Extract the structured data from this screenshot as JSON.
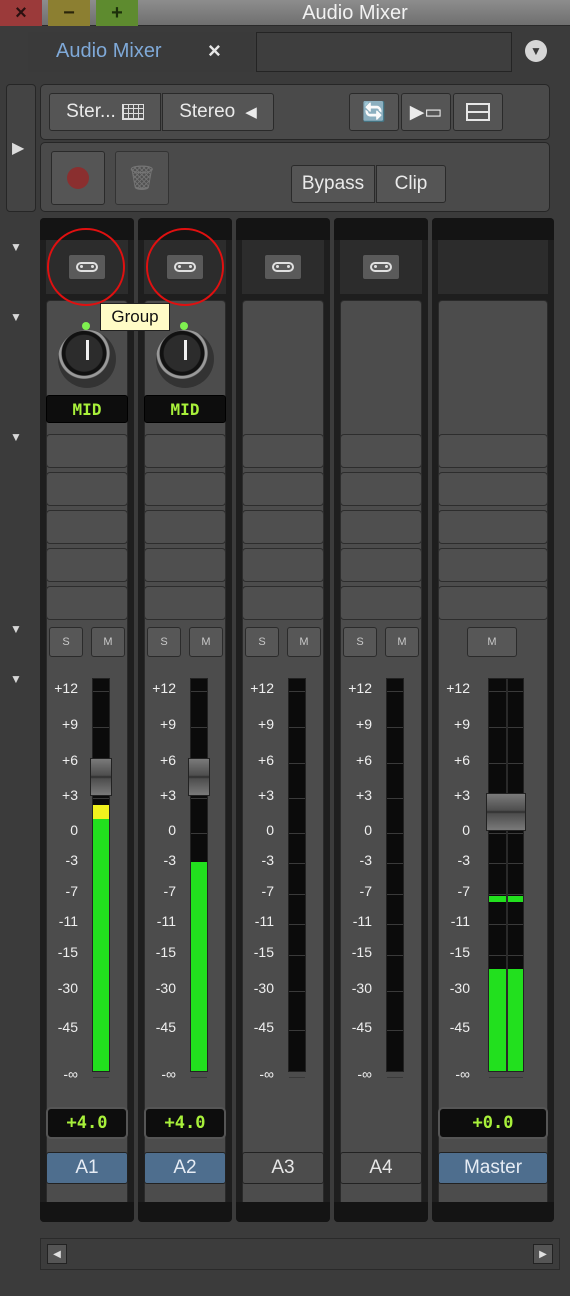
{
  "window": {
    "title": "Audio Mixer",
    "close": "×",
    "minimize": "−",
    "zoom": "+"
  },
  "tab": {
    "label": "Audio Mixer",
    "close": "×",
    "menu_icon": "chevron-down-icon"
  },
  "toolbar": {
    "mode1": "Ster...",
    "mode2": "Stereo",
    "bypass": "Bypass",
    "clip": "Clip"
  },
  "tooltip": "Group",
  "scale_labels": [
    "+12",
    "+9",
    "+6",
    "+3",
    "0",
    "-3",
    "-7",
    "-11",
    "-15",
    "-30",
    "-45",
    "-∞"
  ],
  "channels": [
    {
      "name": "A1",
      "pan": "MID",
      "gain": "+4.0",
      "solo": "S",
      "mute": "M",
      "level": 0.64,
      "peak_yellow": true,
      "fader": 0.75
    },
    {
      "name": "A2",
      "pan": "MID",
      "gain": "+4.0",
      "solo": "S",
      "mute": "M",
      "level": 0.53,
      "peak_yellow": false,
      "fader": 0.75
    },
    {
      "name": "A3",
      "solo": "S",
      "mute": "M",
      "level": 0
    },
    {
      "name": "A4",
      "solo": "S",
      "mute": "M",
      "level": 0
    },
    {
      "name": "Master",
      "gain": "+0.0",
      "mute": "M",
      "level": 0.26,
      "peak": 0.43,
      "fader": 0.66
    }
  ],
  "colors": {
    "accent_tab": "#7fa9d8",
    "meter_green": "#22e01e",
    "meter_yellow": "#f2f21e",
    "display_text": "#a8f03a",
    "channel_button_blue": "#4e6e8e"
  }
}
